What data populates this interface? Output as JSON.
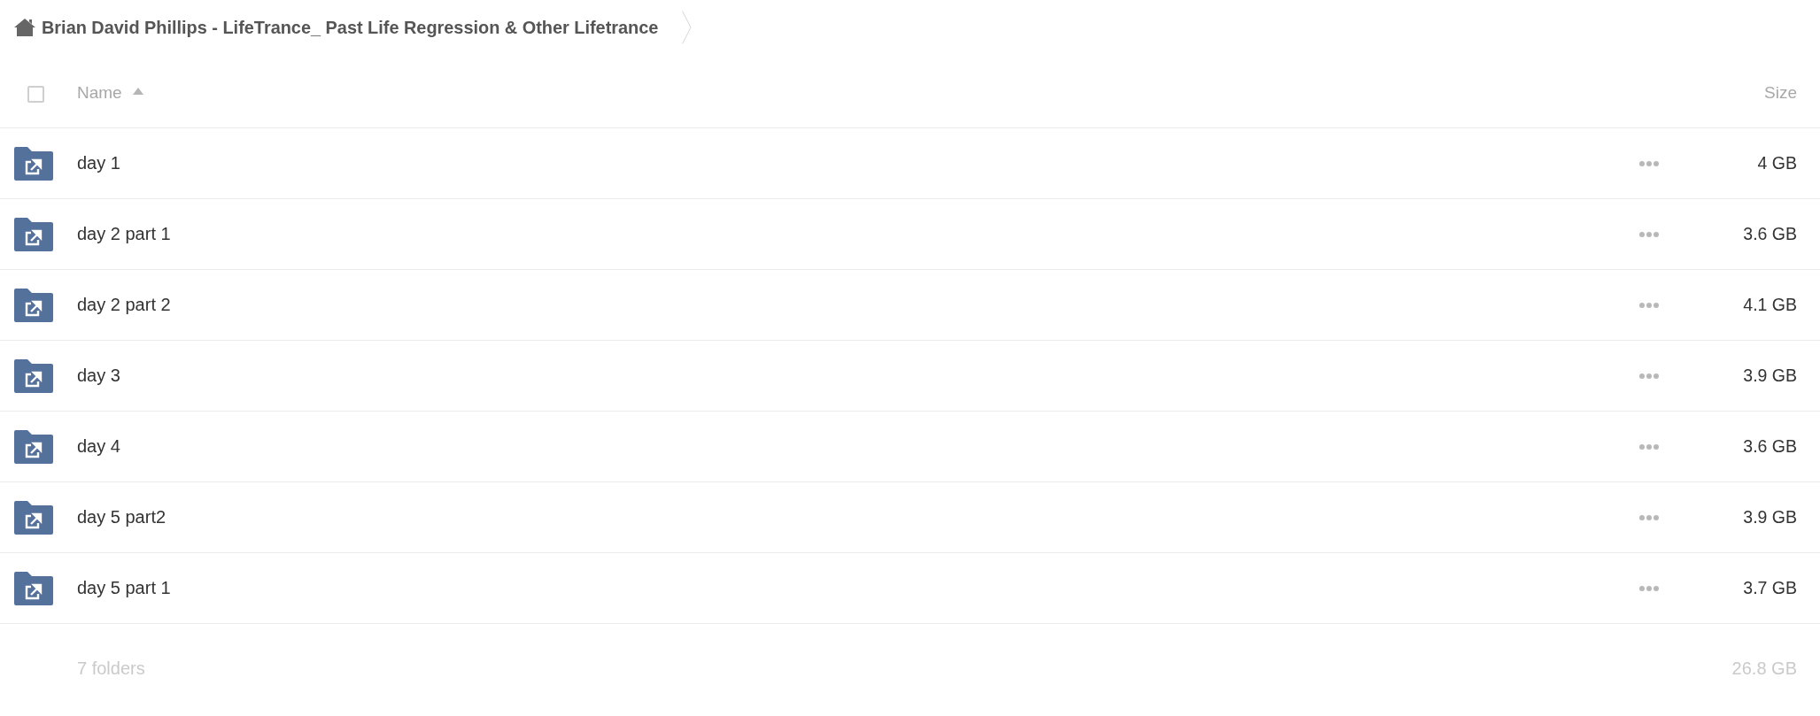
{
  "breadcrumb": {
    "items": [
      {
        "label": "Brian David Phillips - LifeTrance_ Past Life Regression & Other Lifetrance"
      }
    ]
  },
  "table": {
    "select_all": {
      "checked": false
    },
    "columns": [
      {
        "label": "Name",
        "sorted": true
      },
      {
        "label": "Size",
        "sorted": false
      }
    ],
    "rows": [
      {
        "name": "day 1",
        "size": "4 GB"
      },
      {
        "name": "day 2 part 1",
        "size": "3.6 GB"
      },
      {
        "name": "day 2 part 2",
        "size": "4.1 GB"
      },
      {
        "name": "day 3",
        "size": "3.9 GB"
      },
      {
        "name": "day 4",
        "size": "3.6 GB"
      },
      {
        "name": "day 5 part2",
        "size": "3.9 GB"
      },
      {
        "name": "day 5 part 1",
        "size": "3.7 GB"
      }
    ]
  },
  "footer": {
    "count": "7 folders",
    "total": "26.8 GB"
  }
}
